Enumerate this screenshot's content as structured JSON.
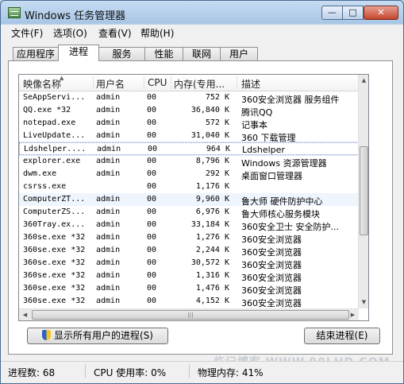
{
  "window": {
    "title": "Windows 任务管理器",
    "min_label": "—",
    "max_label": "□",
    "close_label": "✕"
  },
  "menu": {
    "items": [
      "文件(F)",
      "选项(O)",
      "查看(V)",
      "帮助(H)"
    ]
  },
  "tabs": [
    "应用程序",
    "进程",
    "服务",
    "性能",
    "联网",
    "用户"
  ],
  "active_tab": "进程",
  "columns": [
    "映像名称",
    "用户名",
    "CPU",
    "内存(专用...",
    "描述"
  ],
  "processes": [
    {
      "name": "SeAppServi...",
      "user": "admin",
      "cpu": "00",
      "mem": "752 K",
      "desc": "360安全浏览器 服务组件"
    },
    {
      "name": "QQ.exe *32",
      "user": "admin",
      "cpu": "00",
      "mem": "36,840 K",
      "desc": "腾讯QQ"
    },
    {
      "name": "notepad.exe",
      "user": "admin",
      "cpu": "00",
      "mem": "572 K",
      "desc": "记事本"
    },
    {
      "name": "LiveUpdate...",
      "user": "admin",
      "cpu": "00",
      "mem": "31,040 K",
      "desc": "360 下载管理"
    },
    {
      "name": "Ldshelper....",
      "user": "admin",
      "cpu": "00",
      "mem": "964 K",
      "desc": "Ldshelper"
    },
    {
      "name": "explorer.exe",
      "user": "admin",
      "cpu": "00",
      "mem": "8,796 K",
      "desc": "Windows 资源管理器"
    },
    {
      "name": "dwm.exe",
      "user": "admin",
      "cpu": "00",
      "mem": "292 K",
      "desc": "桌面窗口管理器"
    },
    {
      "name": "csrss.exe",
      "user": "",
      "cpu": "00",
      "mem": "1,176 K",
      "desc": ""
    },
    {
      "name": "ComputerZT...",
      "user": "admin",
      "cpu": "00",
      "mem": "9,960 K",
      "desc": "鲁大师 硬件防护中心"
    },
    {
      "name": "ComputerZS...",
      "user": "admin",
      "cpu": "00",
      "mem": "6,976 K",
      "desc": "鲁大师核心服务模块"
    },
    {
      "name": "360Tray.ex...",
      "user": "admin",
      "cpu": "00",
      "mem": "33,184 K",
      "desc": "360安全卫士 安全防护..."
    },
    {
      "name": "360se.exe *32",
      "user": "admin",
      "cpu": "00",
      "mem": "1,276 K",
      "desc": "360安全浏览器"
    },
    {
      "name": "360se.exe *32",
      "user": "admin",
      "cpu": "00",
      "mem": "2,244 K",
      "desc": "360安全浏览器"
    },
    {
      "name": "360se.exe *32",
      "user": "admin",
      "cpu": "00",
      "mem": "30,572 K",
      "desc": "360安全浏览器"
    },
    {
      "name": "360se.exe *32",
      "user": "admin",
      "cpu": "00",
      "mem": "1,316 K",
      "desc": "360安全浏览器"
    },
    {
      "name": "360se.exe *32",
      "user": "admin",
      "cpu": "00",
      "mem": "1,476 K",
      "desc": "360安全浏览器"
    },
    {
      "name": "360se.exe *32",
      "user": "admin",
      "cpu": "00",
      "mem": "4,152 K",
      "desc": "360安全浏览器"
    }
  ],
  "selected_row": 4,
  "hover_row": 8,
  "buttons": {
    "show_all": "显示所有用户的进程(S)",
    "end_process": "结束进程(E)"
  },
  "status": {
    "processes": "进程数: 68",
    "cpu": "CPU 使用率: 0%",
    "memory": "物理内存: 41%"
  },
  "watermark": "临记博客 WWW.90LHD.COM"
}
